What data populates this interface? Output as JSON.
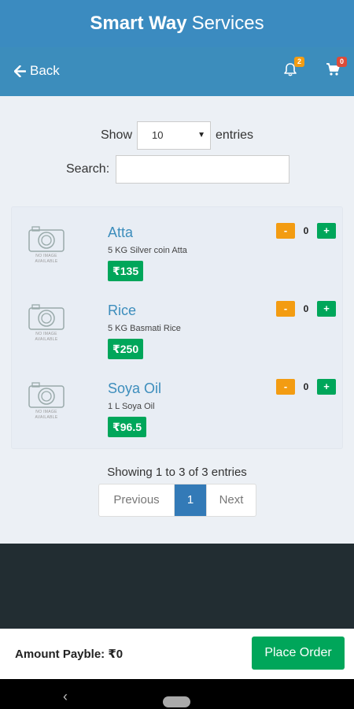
{
  "app": {
    "title_bold": "Smart Way",
    "title_light": "Services"
  },
  "nav": {
    "back_label": "Back",
    "back_icon": "arrow-left-icon",
    "bell_icon": "bell-icon",
    "notifications_count": "2",
    "cart_icon": "cart-icon",
    "cart_count": "0"
  },
  "table_controls": {
    "show_label": "Show",
    "entries_label": "entries",
    "page_size": "10",
    "search_label": "Search:",
    "search_value": ""
  },
  "products": [
    {
      "name": "Atta",
      "description": "5 KG Silver coin Atta",
      "price": "₹135",
      "quantity": "0",
      "image_text": "NO IMAGE AVAILABLE"
    },
    {
      "name": "Rice",
      "description": "5 KG Basmati Rice",
      "price": "₹250",
      "quantity": "0",
      "image_text": "NO IMAGE AVAILABLE"
    },
    {
      "name": "Soya Oil",
      "description": "1 L Soya Oil",
      "price": "₹96.5",
      "quantity": "0",
      "image_text": "NO IMAGE AVAILABLE"
    }
  ],
  "qty_controls": {
    "minus": "-",
    "plus": "+"
  },
  "pagination": {
    "info": "Showing 1 to 3 of 3 entries",
    "previous": "Previous",
    "current": "1",
    "next": "Next"
  },
  "order": {
    "amount_label": "Amount Payble: ₹0",
    "place_order": "Place Order"
  },
  "colors": {
    "header": "#3c8dbc",
    "accent_green": "#00a65a",
    "accent_orange": "#f39c12",
    "footer": "#222d32"
  }
}
